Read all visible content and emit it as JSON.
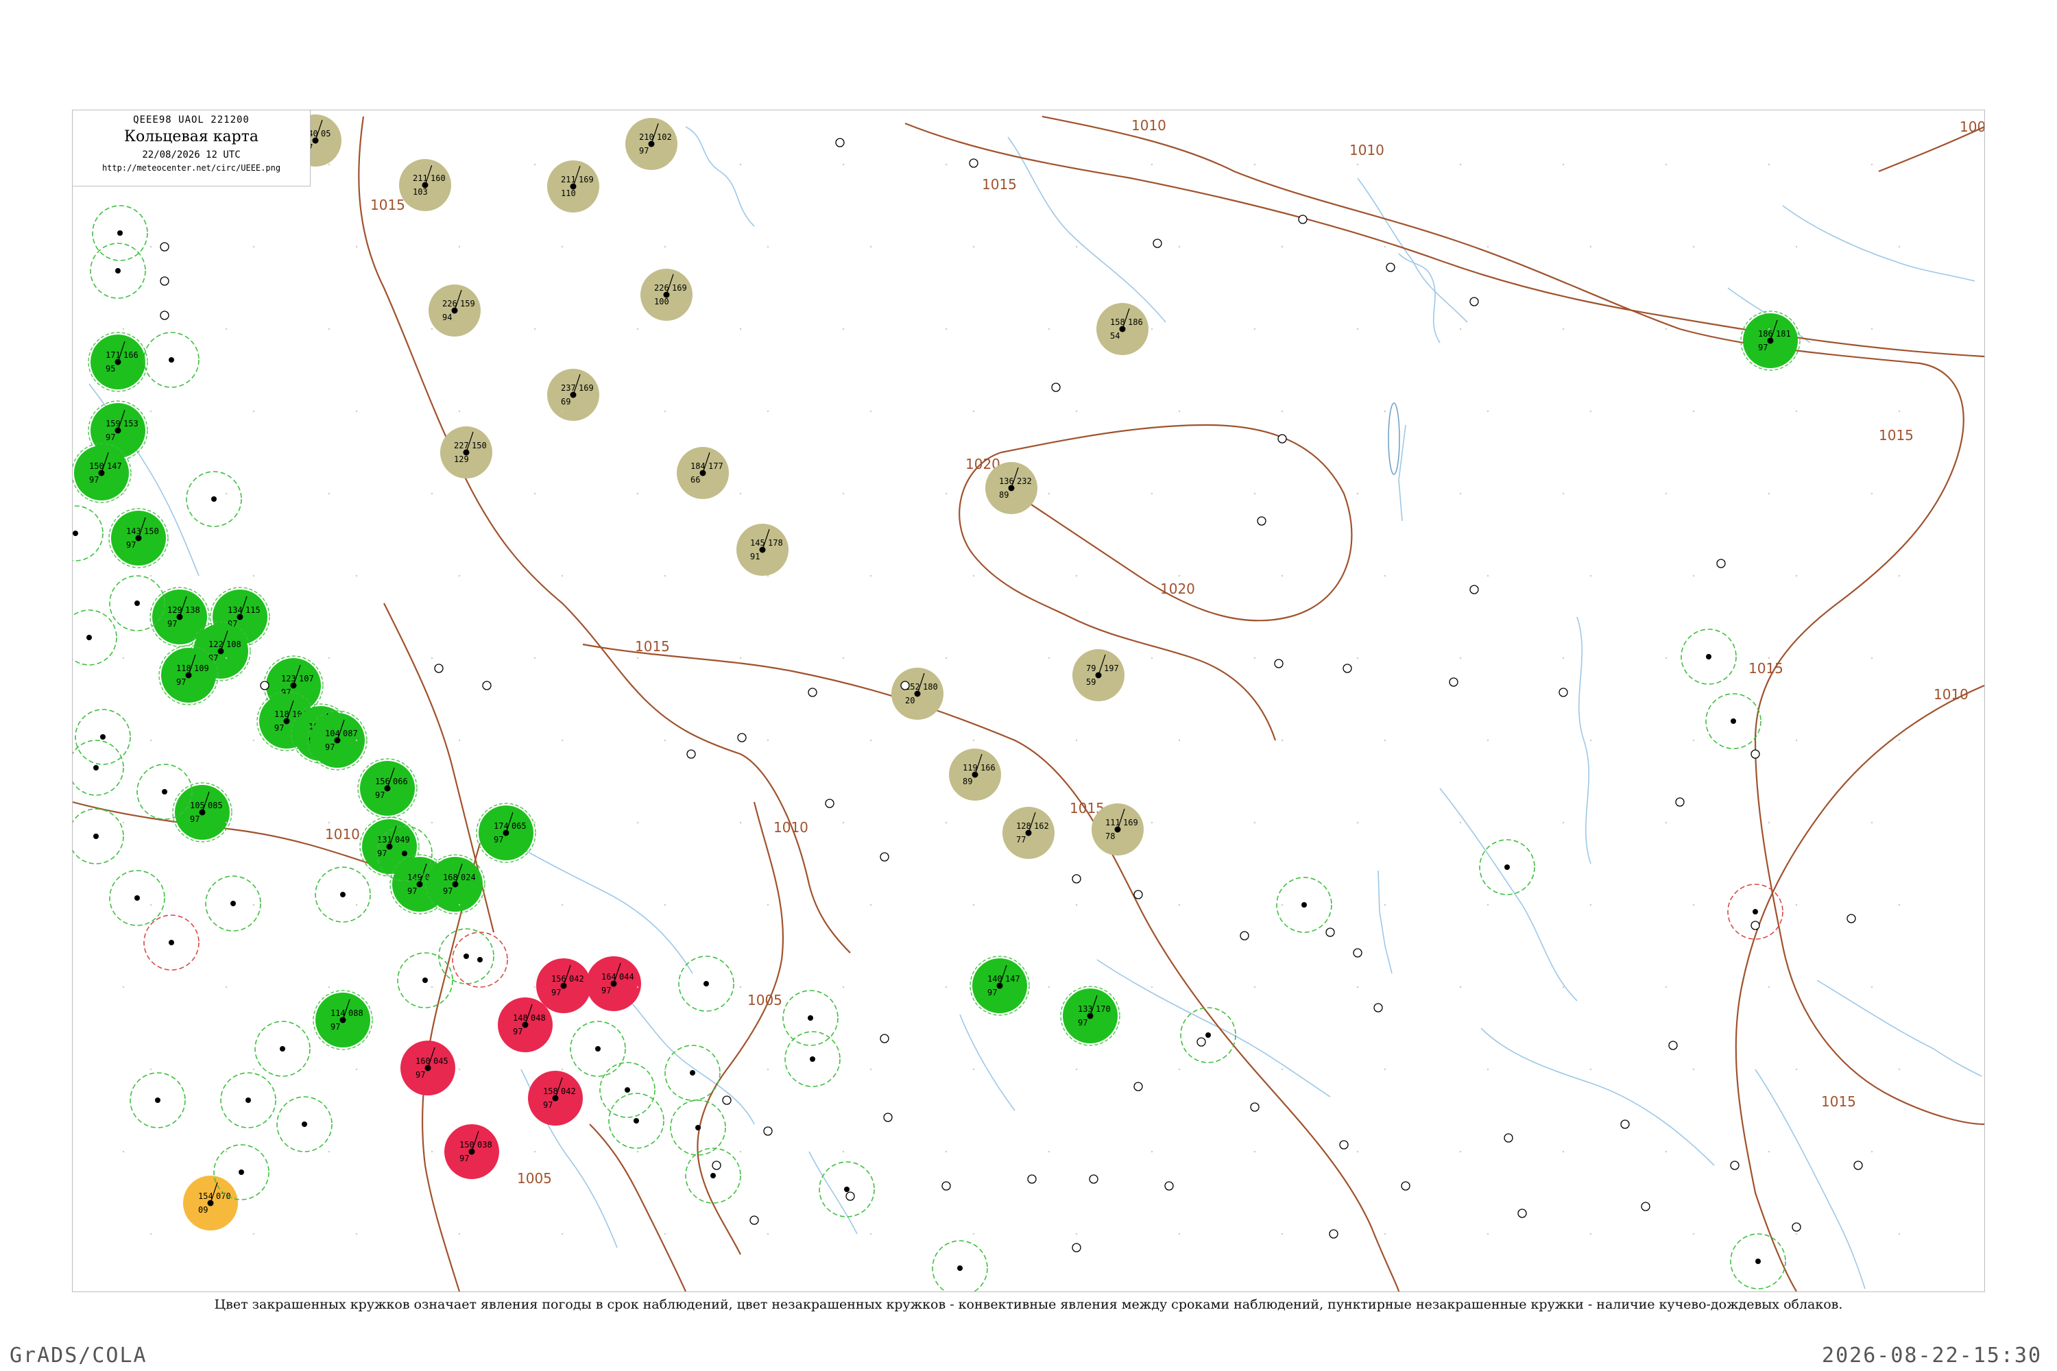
{
  "header": {
    "code": "QEEE98  UAOL  221200",
    "title": "Кольцевая карта",
    "datetime": "22/08/2026 12 UTC",
    "url": "http://meteocenter.net/circ/UEEE.png"
  },
  "caption": "Цвет закрашенных кружков означает явления погоды в срок наблюдений, цвет незакрашенных кружков - конвективные явления между сроками наблюдений, пунктирные незакрашенные кружки - наличие кучево-дождевых облаков.",
  "footer": {
    "left": "GrADS/COLA",
    "right": "2026-08-22-15:30"
  },
  "colors": {
    "isobar": "#a0522d",
    "river": "#9cc8e8",
    "green_fill": "#1ec01e",
    "olive_fill": "#c2bd8a",
    "red_fill": "#e8284f",
    "orange_fill": "#f6b93b",
    "green_ring": "#3fbf3f",
    "red_ring": "#d94848"
  },
  "isobar_labels": [
    "1010",
    "1015",
    "1015",
    "1010",
    "1015",
    "1020",
    "1020",
    "1015",
    "1015",
    "1010",
    "1010",
    "1005",
    "1005",
    "1015",
    "1015",
    "1010",
    "1015",
    "100"
  ],
  "stations": [
    {
      "type": "olive",
      "t": "140",
      "p": "05",
      "n": "97"
    },
    {
      "type": "olive",
      "t": "211",
      "p": "160",
      "n": "103"
    },
    {
      "type": "olive",
      "t": "211",
      "p": "169",
      "n": "110"
    },
    {
      "type": "olive",
      "t": "210",
      "p": "102",
      "n": "97"
    },
    {
      "type": "olive",
      "t": "226",
      "p": "159",
      "n": "94"
    },
    {
      "type": "olive",
      "t": "226",
      "p": "169",
      "n": "100"
    },
    {
      "type": "olive",
      "t": "237",
      "p": "169",
      "n": "69"
    },
    {
      "type": "olive",
      "t": "227",
      "p": "150",
      "n": "129"
    },
    {
      "type": "olive",
      "t": "184",
      "p": "177",
      "n": "66"
    },
    {
      "type": "olive",
      "t": "145",
      "p": "178",
      "n": "91"
    },
    {
      "type": "olive",
      "t": "158",
      "p": "186",
      "n": "54"
    },
    {
      "type": "olive",
      "t": "136",
      "p": "232",
      "n": "89"
    },
    {
      "type": "olive",
      "t": "152",
      "p": "180",
      "n": "20"
    },
    {
      "type": "olive",
      "t": "79",
      "p": "197",
      "n": "59"
    },
    {
      "type": "olive",
      "t": "119",
      "p": "166",
      "n": "89"
    },
    {
      "type": "olive",
      "t": "128",
      "p": "162",
      "n": "77"
    },
    {
      "type": "olive",
      "t": "111",
      "p": "169",
      "n": "78"
    },
    {
      "type": "green",
      "t": "171",
      "p": "166",
      "n": "95"
    },
    {
      "type": "green",
      "t": "159",
      "p": "153",
      "n": "97"
    },
    {
      "type": "green",
      "t": "150",
      "p": "147",
      "n": "97"
    },
    {
      "type": "green",
      "t": "143",
      "p": "150",
      "n": "97"
    },
    {
      "type": "green",
      "t": "129",
      "p": "138",
      "n": "97"
    },
    {
      "type": "green",
      "t": "134",
      "p": "115",
      "n": "97"
    },
    {
      "type": "green",
      "t": "122",
      "p": "108",
      "n": "97"
    },
    {
      "type": "green",
      "t": "118",
      "p": "109",
      "n": "97"
    },
    {
      "type": "green",
      "t": "123",
      "p": "107",
      "n": "97"
    },
    {
      "type": "green",
      "t": "118",
      "p": "104",
      "n": "97"
    },
    {
      "type": "green",
      "t": "107",
      "p": "092",
      "n": "97"
    },
    {
      "type": "green",
      "t": "104",
      "p": "087",
      "n": "97"
    },
    {
      "type": "green",
      "t": "156",
      "p": "066",
      "n": "97"
    },
    {
      "type": "green",
      "t": "174",
      "p": "065",
      "n": "97"
    },
    {
      "type": "green",
      "t": "131",
      "p": "049",
      "n": "97"
    },
    {
      "type": "green",
      "t": "149",
      "p": "042",
      "n": "97"
    },
    {
      "type": "green",
      "t": "168",
      "p": "024",
      "n": "97"
    },
    {
      "type": "green",
      "t": "114",
      "p": "088",
      "n": "97"
    },
    {
      "type": "green",
      "t": "105",
      "p": "085",
      "n": "97"
    },
    {
      "type": "green",
      "t": "186",
      "p": "181",
      "n": "97"
    },
    {
      "type": "green",
      "t": "140",
      "p": "147",
      "n": "97"
    },
    {
      "type": "green",
      "t": "133",
      "p": "170",
      "n": "97"
    },
    {
      "type": "red",
      "t": "164",
      "p": "044",
      "n": "97"
    },
    {
      "type": "red",
      "t": "156",
      "p": "042",
      "n": "97"
    },
    {
      "type": "red",
      "t": "148",
      "p": "048",
      "n": "97"
    },
    {
      "type": "red",
      "t": "158",
      "p": "042",
      "n": "97"
    },
    {
      "type": "red",
      "t": "160",
      "p": "045",
      "n": "97"
    },
    {
      "type": "red",
      "t": "150",
      "p": "038",
      "n": "97"
    },
    {
      "type": "orange",
      "t": "154",
      "p": "070",
      "n": "09"
    }
  ]
}
